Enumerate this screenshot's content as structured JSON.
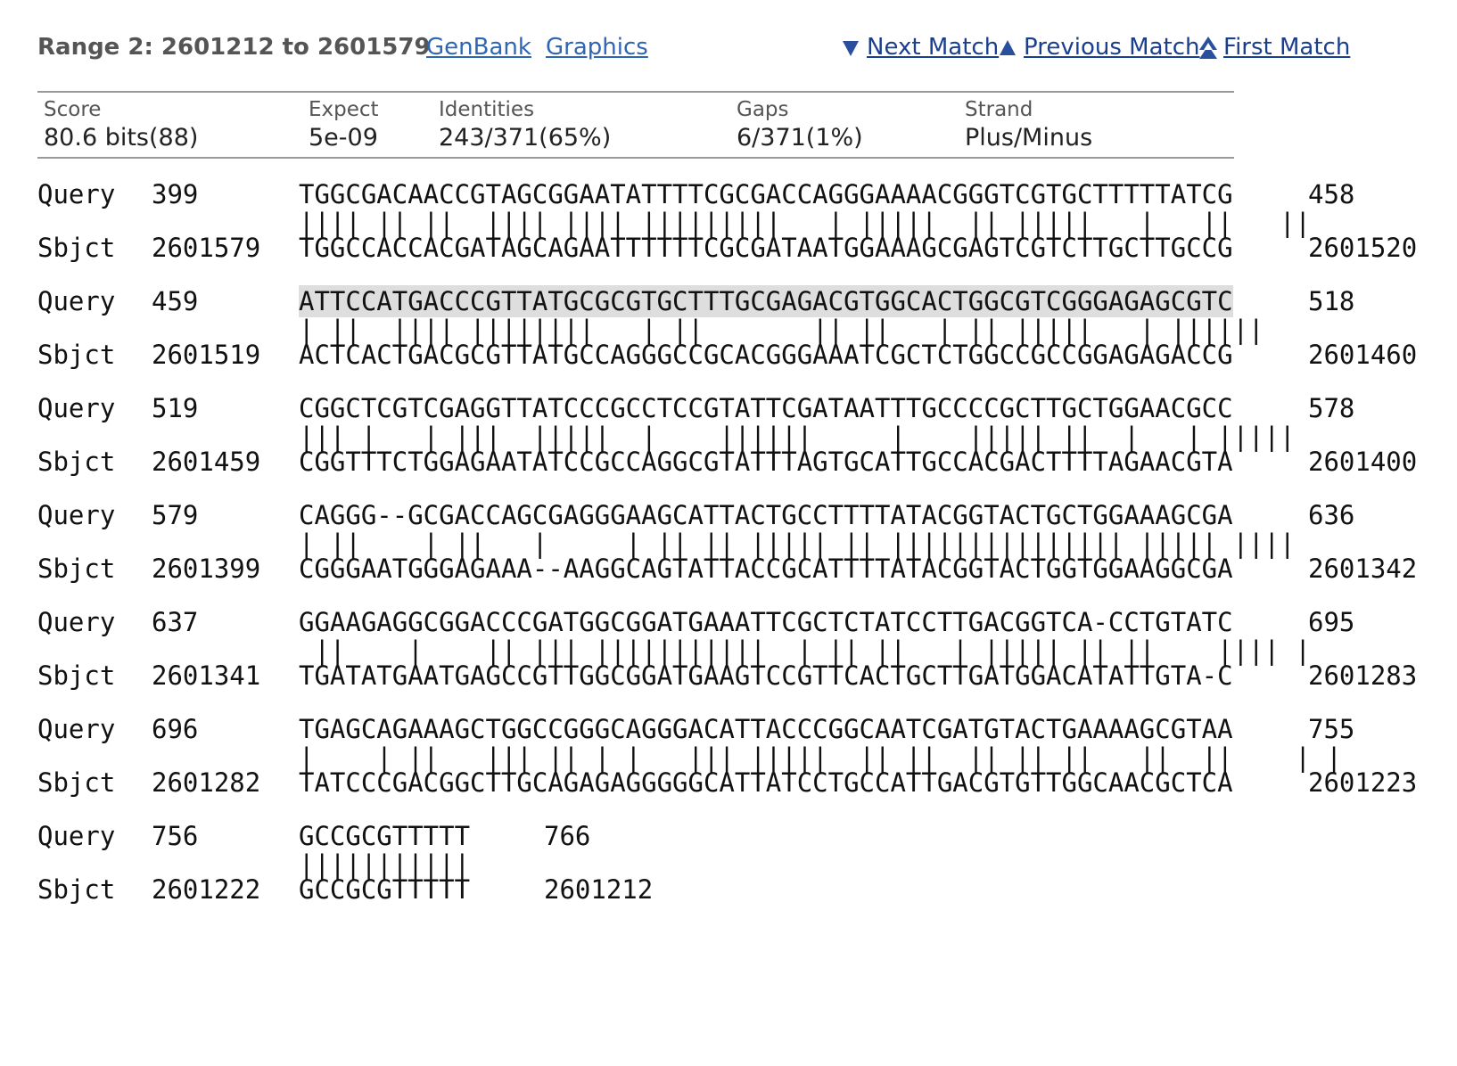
{
  "header": {
    "range_title": "Range 2: 2601212 to 2601579",
    "links": {
      "genbank": "GenBank",
      "graphics": "Graphics"
    },
    "nav": {
      "next_match": "Next Match",
      "previous_match": "Previous Match",
      "first_match": "First Match",
      "link_color": "#1b3f8f",
      "icon_color": "#2a4f9c"
    }
  },
  "stats": {
    "score_label": "Score",
    "score_value": "80.6 bits(88)",
    "expect_label": "Expect",
    "expect_value": "5e-09",
    "identities_label": "Identities",
    "identities_value": "243/371(65%)",
    "gaps_label": "Gaps",
    "gaps_value": "6/371(1%)",
    "strand_label": "Strand",
    "strand_value": "Plus/Minus"
  },
  "alignment": [
    {
      "query_label": "Query",
      "query_start": "399",
      "query_seq": "TGGCGACAACCGTAGCGGAATATTTTCGCGACCAGGGAAAACGGGTCGTGCTTTTTATCG",
      "query_end": "458",
      "midline": "|||| || ||  |||| |||| |||||||||   | |||||  || |||||   |   ||   ||",
      "sbjct_label": "Sbjct",
      "sbjct_start": "2601579",
      "sbjct_seq": "TGGCCACCACGATAGCAGAATTTTTTCGCGATAATGGAAAGCGAGTCGTCTTGCTTGCCG",
      "sbjct_end": "2601520",
      "highlight": false
    },
    {
      "query_label": "Query",
      "query_start": "459",
      "query_seq": "ATTCCATGACCCGTTATGCGCGTGCTTTGCGAGACGTGGCACTGGCGTCGGGAGAGCGTC",
      "query_end": "518",
      "midline": "| ||  |||| ||||||||   | ||       || ||   | || |||||   | ||||||",
      "sbjct_label": "Sbjct",
      "sbjct_start": "2601519",
      "sbjct_seq": "ACTCACTGACGCGTTATGCCAGGGCCGCACGGGAAATCGCTCTGGCCGCCGGAGAGACCG",
      "sbjct_end": "2601460",
      "highlight": true
    },
    {
      "query_label": "Query",
      "query_start": "519",
      "query_seq": "CGGCTCGTCGAGGTTATCCCGCCTCCGTATTCGATAATTTGCCCCGCTTGCTGGAACGCC",
      "query_end": "578",
      "midline": "||| |   | |||  |||||  |    ||||||     |    ||||| ||  |   | |||||",
      "sbjct_label": "Sbjct",
      "sbjct_start": "2601459",
      "sbjct_seq": "CGGTTTCTGGAGAATATCCGCCAGGCGTATTTAGTGCATTGCCACGACTTTTAGAACGTA",
      "sbjct_end": "2601400",
      "highlight": false
    },
    {
      "query_label": "Query",
      "query_start": "579",
      "query_seq": "CAGGG--GCGACCAGCGAGGGAAGCATTACTGCCTTTTATACGGTACTGCTGGAAAGCGA",
      "query_end": "636",
      "midline": "| ||    | ||   |     | || || ||||| || ||||||||||||||| ||||| ||||",
      "sbjct_label": "Sbjct",
      "sbjct_start": "2601399",
      "sbjct_seq": "CGGGAATGGGAGAAA--AAGGCAGTATTACCGCATTTTATACGGTACTGGTGGAAGGCGA",
      "sbjct_end": "2601342",
      "highlight": false
    },
    {
      "query_label": "Query",
      "query_start": "637",
      "query_seq": "GGAAGAGGCGGACCCGATGGCGGATGAAATTCGCTCTATCCTTGACGGTCA-CCTGTATC",
      "query_end": "695",
      "midline": " ||    |    || ||| |||||||||||  | || ||   | ||||| || ||    |||| |",
      "sbjct_label": "Sbjct",
      "sbjct_start": "2601341",
      "sbjct_seq": "TGATATGAATGAGCCGTTGGCGGATGAAGTCCGTTCACTGCTTGATGGACATATTGTA-C",
      "sbjct_end": "2601283",
      "highlight": false
    },
    {
      "query_label": "Query",
      "query_start": "696",
      "query_seq": "TGAGCAGAAAGCTGGCCGGGCAGGGACATTACCCGGCAATCGATGTACTGAAAAGCGTAA",
      "query_end": "755",
      "midline": "|    | ||   ||| || | |   ||| |||||  || ||  || || ||   ||  ||    | |",
      "sbjct_label": "Sbjct",
      "sbjct_start": "2601282",
      "sbjct_seq": "TATCCCGACGGCTTGCAGAGAGGGGGCATTATCCTGCCATTGACGTGTTGGCAACGCTCA",
      "sbjct_end": "2601223",
      "highlight": false
    },
    {
      "query_label": "Query",
      "query_start": "756",
      "query_seq": "GCCGCGTTTTT",
      "query_end": "766",
      "midline": "|||||||||||",
      "sbjct_label": "Sbjct",
      "sbjct_start": "2601222",
      "sbjct_seq": "GCCGCGTTTTT",
      "sbjct_end": "2601212",
      "highlight": false
    }
  ]
}
